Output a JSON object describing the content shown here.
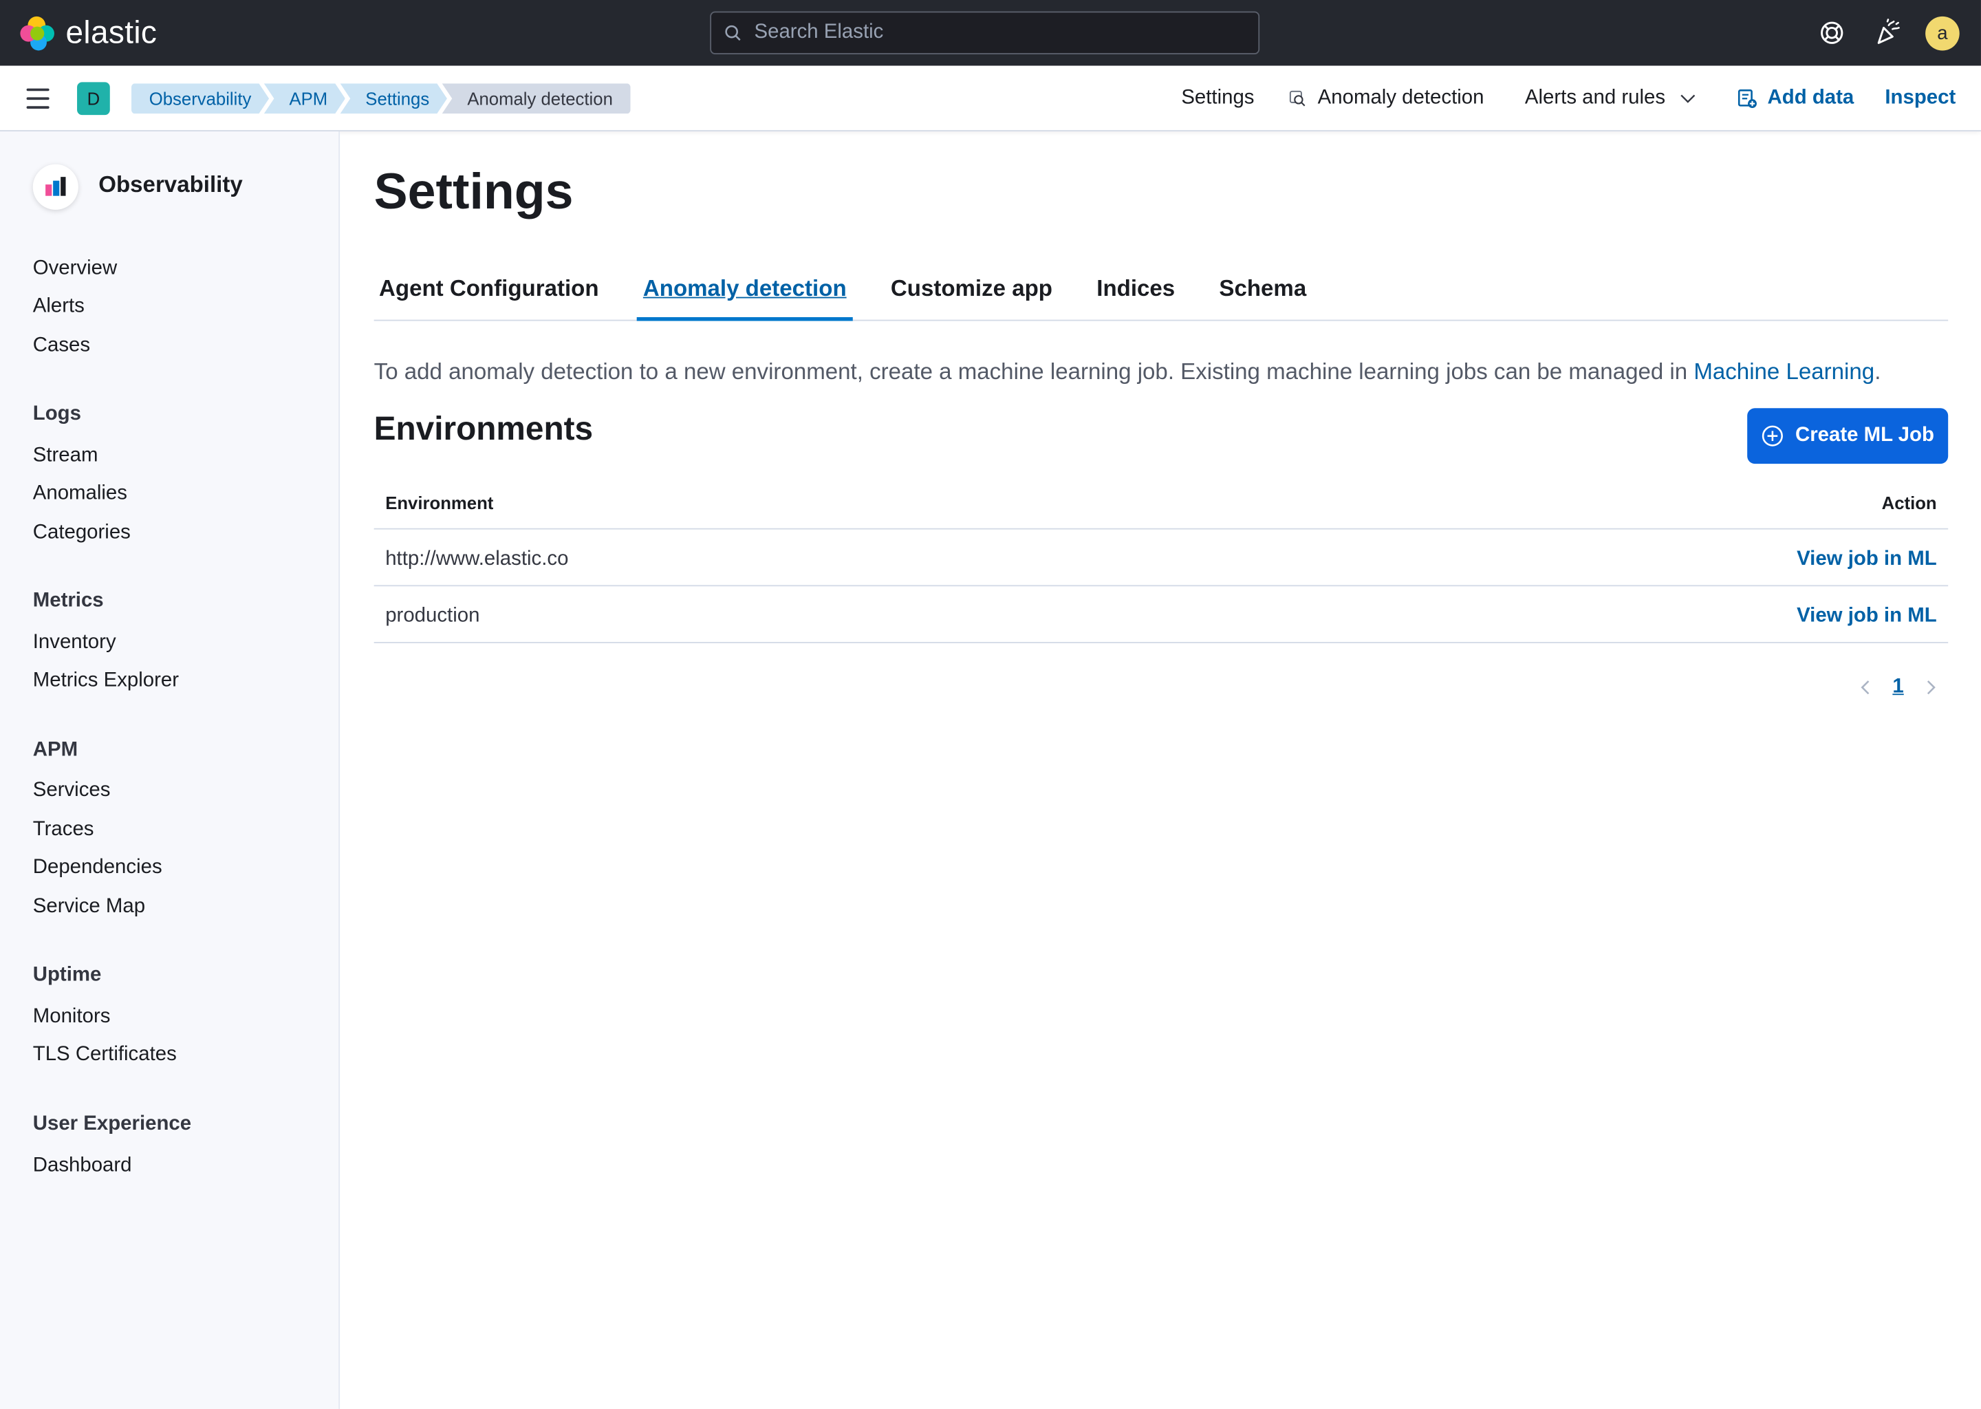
{
  "header": {
    "logo_text": "elastic",
    "search_placeholder": "Search Elastic",
    "avatar_initial": "a",
    "icons": [
      "help-icon",
      "newsfeed-icon"
    ]
  },
  "subheader": {
    "space_initial": "D",
    "breadcrumbs": [
      "Observability",
      "APM",
      "Settings",
      "Anomaly detection"
    ],
    "links": {
      "settings": "Settings",
      "anomaly_detection": "Anomaly detection",
      "alerts_and_rules": "Alerts and rules",
      "add_data": "Add data",
      "inspect": "Inspect"
    }
  },
  "sidebar": {
    "title": "Observability",
    "top_items": [
      "Overview",
      "Alerts",
      "Cases"
    ],
    "groups": [
      {
        "label": "Logs",
        "items": [
          "Stream",
          "Anomalies",
          "Categories"
        ]
      },
      {
        "label": "Metrics",
        "items": [
          "Inventory",
          "Metrics Explorer"
        ]
      },
      {
        "label": "APM",
        "items": [
          "Services",
          "Traces",
          "Dependencies",
          "Service Map"
        ]
      },
      {
        "label": "Uptime",
        "items": [
          "Monitors",
          "TLS Certificates"
        ]
      },
      {
        "label": "User Experience",
        "items": [
          "Dashboard"
        ]
      }
    ]
  },
  "main": {
    "title": "Settings",
    "tabs": [
      "Agent Configuration",
      "Anomaly detection",
      "Customize app",
      "Indices",
      "Schema"
    ],
    "active_tab": "Anomaly detection",
    "description": "To add anomaly detection to a new environment, create a machine learning job. Existing machine learning jobs can be managed in ",
    "description_link": "Machine Learning",
    "description_end": ".",
    "section_title": "Environments",
    "create_button": "Create ML Job",
    "table": {
      "columns": [
        "Environment",
        "Action"
      ],
      "rows": [
        {
          "environment": "http://www.elastic.co",
          "action": "View job in ML"
        },
        {
          "environment": "production",
          "action": "View job in ML"
        }
      ]
    },
    "pagination": {
      "current_page": "1"
    }
  },
  "colors": {
    "header_bg": "#25282f",
    "primary": "#0b64dd",
    "link": "#0061a6",
    "breadcrumb_bg": "#cce4f5",
    "sidebar_bg": "#f7f8fc"
  }
}
